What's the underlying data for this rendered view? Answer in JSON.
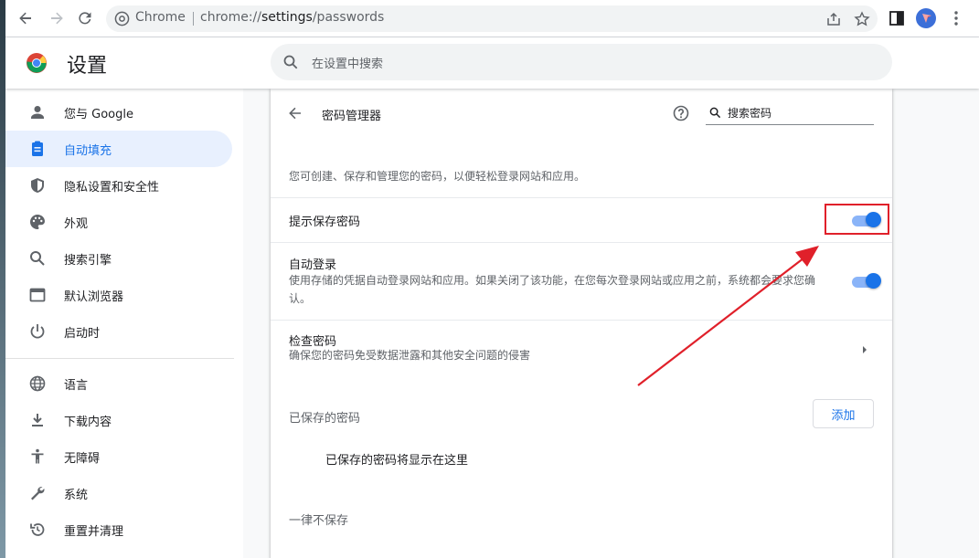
{
  "browser": {
    "site_chip": "Chrome",
    "url_prefix": "chrome://",
    "url_path": "settings",
    "url_suffix": "/passwords"
  },
  "header": {
    "title": "设置",
    "search_placeholder": "在设置中搜索"
  },
  "sidebar": {
    "items": [
      {
        "label": "您与 Google",
        "icon": "person-icon"
      },
      {
        "label": "自动填充",
        "icon": "autofill-clipboard-icon",
        "active": true
      },
      {
        "label": "隐私设置和安全性",
        "icon": "shield-icon"
      },
      {
        "label": "外观",
        "icon": "palette-icon"
      },
      {
        "label": "搜索引擎",
        "icon": "search-icon"
      },
      {
        "label": "默认浏览器",
        "icon": "browser-window-icon"
      },
      {
        "label": "启动时",
        "icon": "power-icon"
      },
      {
        "label": "语言",
        "icon": "globe-icon"
      },
      {
        "label": "下载内容",
        "icon": "download-icon"
      },
      {
        "label": "无障碍",
        "icon": "accessibility-icon"
      },
      {
        "label": "系统",
        "icon": "wrench-icon"
      },
      {
        "label": "重置并清理",
        "icon": "restore-icon"
      }
    ]
  },
  "password_manager": {
    "title": "密码管理器",
    "search_placeholder": "搜索密码",
    "description": "您可创建、保存和管理您的密码，以便轻松登录网站和应用。",
    "offer_to_save": {
      "label": "提示保存密码",
      "enabled": true
    },
    "auto_signin": {
      "label": "自动登录",
      "sublabel": "使用存储的凭据自动登录网站和应用。如果关闭了该功能，在您每次登录网站或应用之前，系统都会要求您确认。",
      "enabled": true
    },
    "check_passwords": {
      "label": "检查密码",
      "sublabel": "确保您的密码免受数据泄露和其他安全问题的侵害"
    },
    "saved_section": {
      "label": "已保存的密码",
      "add_button": "添加",
      "empty_message": "已保存的密码将显示在这里"
    },
    "never_saved_section": {
      "label": "一律不保存"
    }
  },
  "colors": {
    "accent": "#1a73e8",
    "annotation": "#e0202a"
  }
}
